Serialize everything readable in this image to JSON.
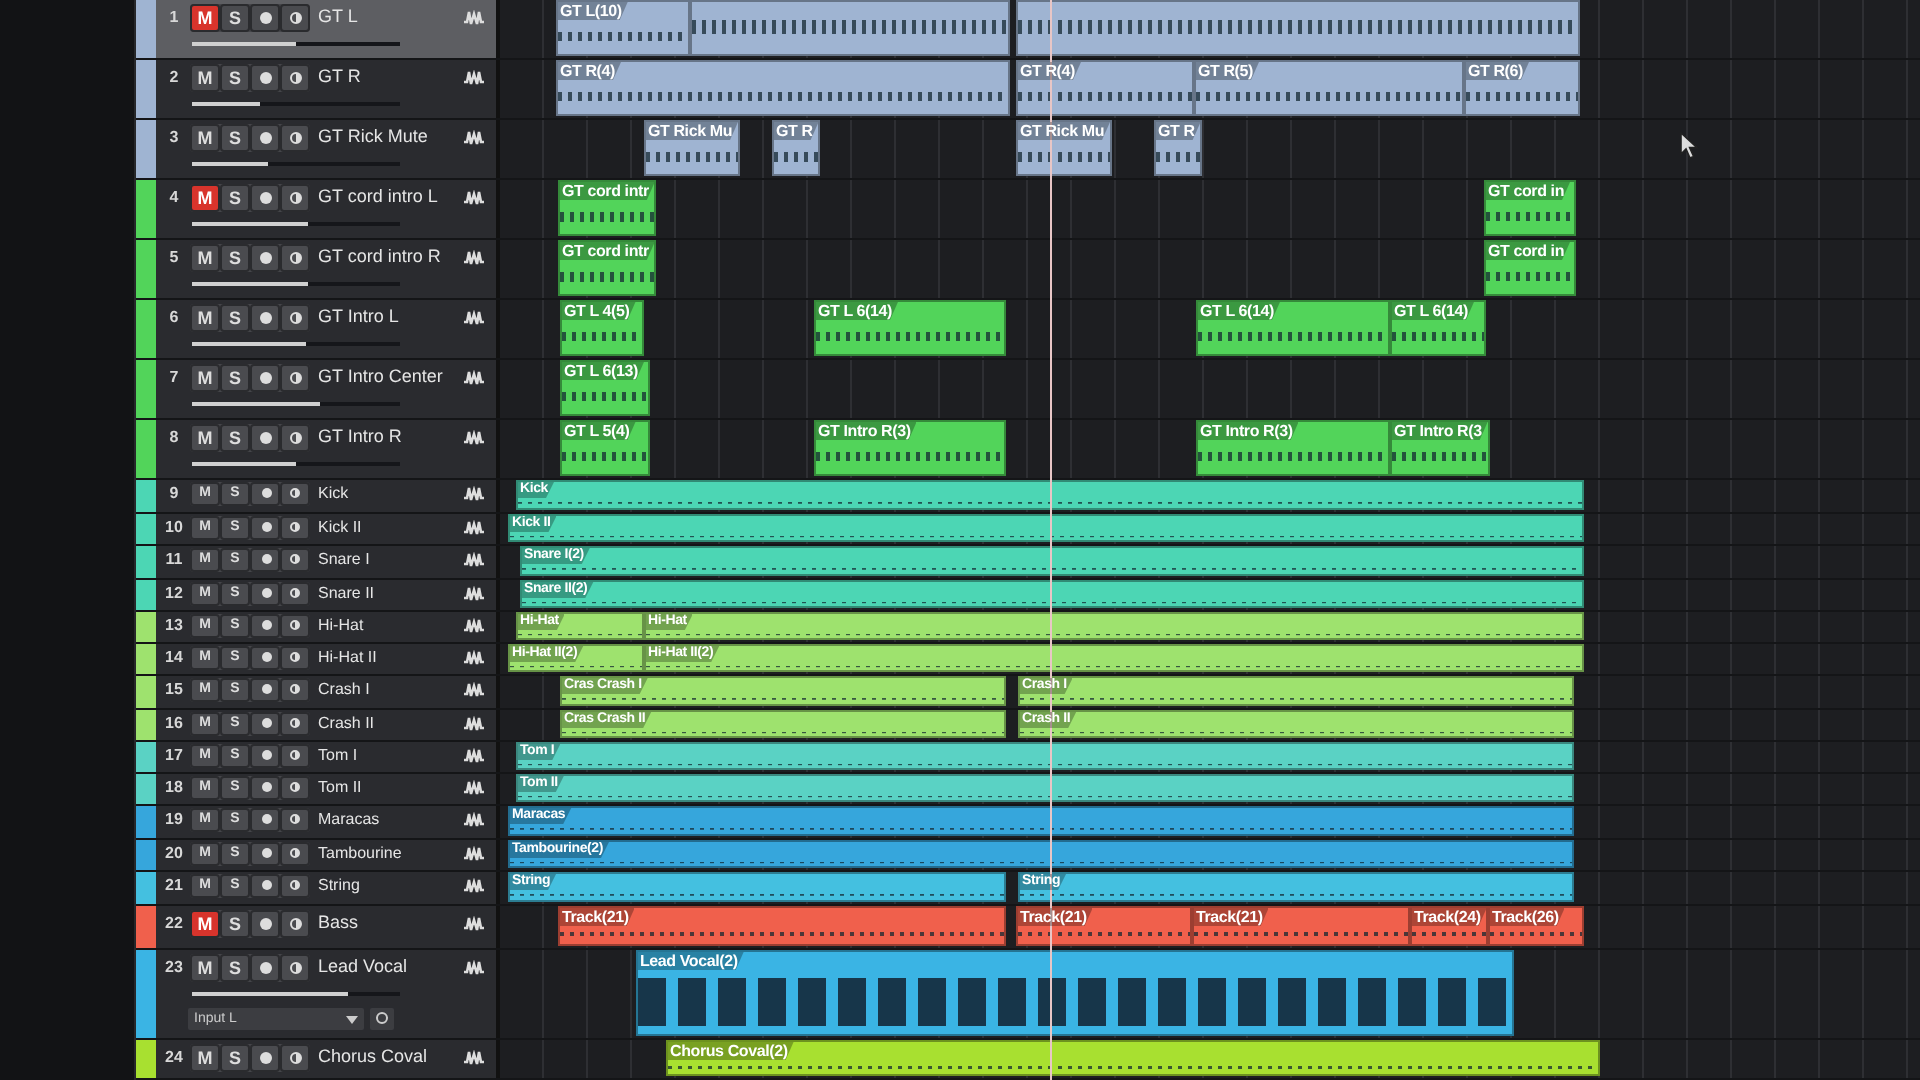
{
  "tracks": [
    {
      "number": "1",
      "mute": "M",
      "solo": "S",
      "name": "GT L",
      "color": "#9fb4d2",
      "muted": true,
      "selected": true,
      "level": 0.5,
      "clips": [
        {
          "label": "GT L(10)"
        }
      ]
    },
    {
      "number": "2",
      "mute": "M",
      "solo": "S",
      "name": "GT R",
      "color": "#9fb4d2",
      "muted": false,
      "selected": false,
      "level": 0.33,
      "clips": [
        {
          "label": "GT R(4)"
        },
        {
          "label": "GT R(4)"
        },
        {
          "label": "GT R(5)"
        },
        {
          "label": "GT R(6)"
        }
      ]
    },
    {
      "number": "3",
      "mute": "M",
      "solo": "S",
      "name": "GT Rick Mute",
      "color": "#9fb4d2",
      "muted": false,
      "selected": false,
      "level": 0.37,
      "clips": [
        {
          "label": "GT Rick Mu"
        },
        {
          "label": "GT R"
        },
        {
          "label": "GT Rick Mu"
        },
        {
          "label": "GT R"
        }
      ]
    },
    {
      "number": "4",
      "mute": "M",
      "solo": "S",
      "name": "GT cord intro L",
      "color": "#52d45a",
      "muted": true,
      "selected": false,
      "level": 0.56,
      "clips": [
        {
          "label": "GT cord intr"
        },
        {
          "label": "GT cord in"
        }
      ]
    },
    {
      "number": "5",
      "mute": "M",
      "solo": "S",
      "name": "GT cord intro R",
      "color": "#52d45a",
      "muted": false,
      "selected": false,
      "level": 0.56,
      "clips": [
        {
          "label": "GT cord intr"
        },
        {
          "label": "GT cord in"
        }
      ]
    },
    {
      "number": "6",
      "mute": "M",
      "solo": "S",
      "name": "GT Intro L",
      "color": "#52d45a",
      "muted": false,
      "selected": false,
      "level": 0.55,
      "clips": [
        {
          "label": "GT L 4(5)"
        },
        {
          "label": "GT L 6(14)"
        },
        {
          "label": "GT L 6(14)"
        },
        {
          "label": "GT L 6(14)"
        }
      ]
    },
    {
      "number": "7",
      "mute": "M",
      "solo": "S",
      "name": "GT Intro Center",
      "color": "#52d45a",
      "muted": false,
      "selected": false,
      "level": 0.62,
      "clips": [
        {
          "label": "GT L 6(13)"
        }
      ]
    },
    {
      "number": "8",
      "mute": "M",
      "solo": "S",
      "name": "GT Intro R",
      "color": "#52d45a",
      "muted": false,
      "selected": false,
      "level": 0.5,
      "clips": [
        {
          "label": "GT L 5(4)"
        },
        {
          "label": "GT Intro R(3)"
        },
        {
          "label": "GT Intro R(3)"
        },
        {
          "label": "GT Intro R(3"
        }
      ]
    },
    {
      "number": "9",
      "mute": "M",
      "solo": "S",
      "name": "Kick",
      "color": "#4cd6b4",
      "muted": false,
      "selected": false,
      "clips": [
        {
          "label": "Kick"
        }
      ]
    },
    {
      "number": "10",
      "mute": "M",
      "solo": "S",
      "name": "Kick II",
      "color": "#4cd6b4",
      "muted": false,
      "selected": false,
      "clips": [
        {
          "label": "Kick II"
        }
      ]
    },
    {
      "number": "11",
      "mute": "M",
      "solo": "S",
      "name": "Snare I",
      "color": "#4cd6b4",
      "muted": false,
      "selected": false,
      "clips": [
        {
          "label": "Snare I(2)"
        }
      ]
    },
    {
      "number": "12",
      "mute": "M",
      "solo": "S",
      "name": "Snare II",
      "color": "#4cd6b4",
      "muted": false,
      "selected": false,
      "clips": [
        {
          "label": "Snare II(2)"
        }
      ]
    },
    {
      "number": "13",
      "mute": "M",
      "solo": "S",
      "name": "Hi-Hat",
      "color": "#9ee26e",
      "muted": false,
      "selected": false,
      "clips": [
        {
          "label": "Hi-Hat"
        },
        {
          "label": "Hi-Hat"
        }
      ]
    },
    {
      "number": "14",
      "mute": "M",
      "solo": "S",
      "name": "Hi-Hat II",
      "color": "#9ee26e",
      "muted": false,
      "selected": false,
      "clips": [
        {
          "label": "Hi-Hat II(2)"
        },
        {
          "label": "Hi-Hat II(2)"
        }
      ]
    },
    {
      "number": "15",
      "mute": "M",
      "solo": "S",
      "name": "Crash I",
      "color": "#9ee26e",
      "muted": false,
      "selected": false,
      "clips": [
        {
          "label": "Cras Crash I"
        },
        {
          "label": "Crash I"
        }
      ]
    },
    {
      "number": "16",
      "mute": "M",
      "solo": "S",
      "name": "Crash II",
      "color": "#9ee26e",
      "muted": false,
      "selected": false,
      "clips": [
        {
          "label": "Cras Crash II"
        },
        {
          "label": "Crash II"
        }
      ]
    },
    {
      "number": "17",
      "mute": "M",
      "solo": "S",
      "name": "Tom I",
      "color": "#5ad2c4",
      "muted": false,
      "selected": false,
      "clips": [
        {
          "label": "Tom I"
        }
      ]
    },
    {
      "number": "18",
      "mute": "M",
      "solo": "S",
      "name": "Tom II",
      "color": "#5ad2c4",
      "muted": false,
      "selected": false,
      "clips": [
        {
          "label": "Tom II"
        }
      ]
    },
    {
      "number": "19",
      "mute": "M",
      "solo": "S",
      "name": "Maracas",
      "color": "#36a6dc",
      "muted": false,
      "selected": false,
      "clips": [
        {
          "label": "Maracas"
        }
      ]
    },
    {
      "number": "20",
      "mute": "M",
      "solo": "S",
      "name": "Tambourine",
      "color": "#36a6dc",
      "muted": false,
      "selected": false,
      "clips": [
        {
          "label": "Tambourine(2)"
        }
      ]
    },
    {
      "number": "21",
      "mute": "M",
      "solo": "S",
      "name": "String",
      "color": "#44c0e0",
      "muted": false,
      "selected": false,
      "clips": [
        {
          "label": "String"
        },
        {
          "label": "String"
        }
      ]
    },
    {
      "number": "22",
      "mute": "M",
      "solo": "S",
      "name": "Bass",
      "color": "#f0604c",
      "muted": true,
      "selected": false,
      "clips": [
        {
          "label": "Track(21)"
        },
        {
          "label": "Track(21)"
        },
        {
          "label": "Track(21)"
        },
        {
          "label": "Track(24)"
        },
        {
          "label": "Track(26)"
        }
      ]
    },
    {
      "number": "23",
      "mute": "M",
      "solo": "S",
      "name": "Lead Vocal",
      "color": "#3ab4e4",
      "muted": false,
      "selected": false,
      "level": 0.75,
      "input": "Input L",
      "clips": [
        {
          "label": "Lead Vocal(2)"
        }
      ]
    },
    {
      "number": "24",
      "mute": "M",
      "solo": "S",
      "name": "Chorus Coval",
      "color": "#a8e030",
      "muted": false,
      "selected": false,
      "clips": [
        {
          "label": "Chorus Coval(2)"
        }
      ]
    }
  ]
}
